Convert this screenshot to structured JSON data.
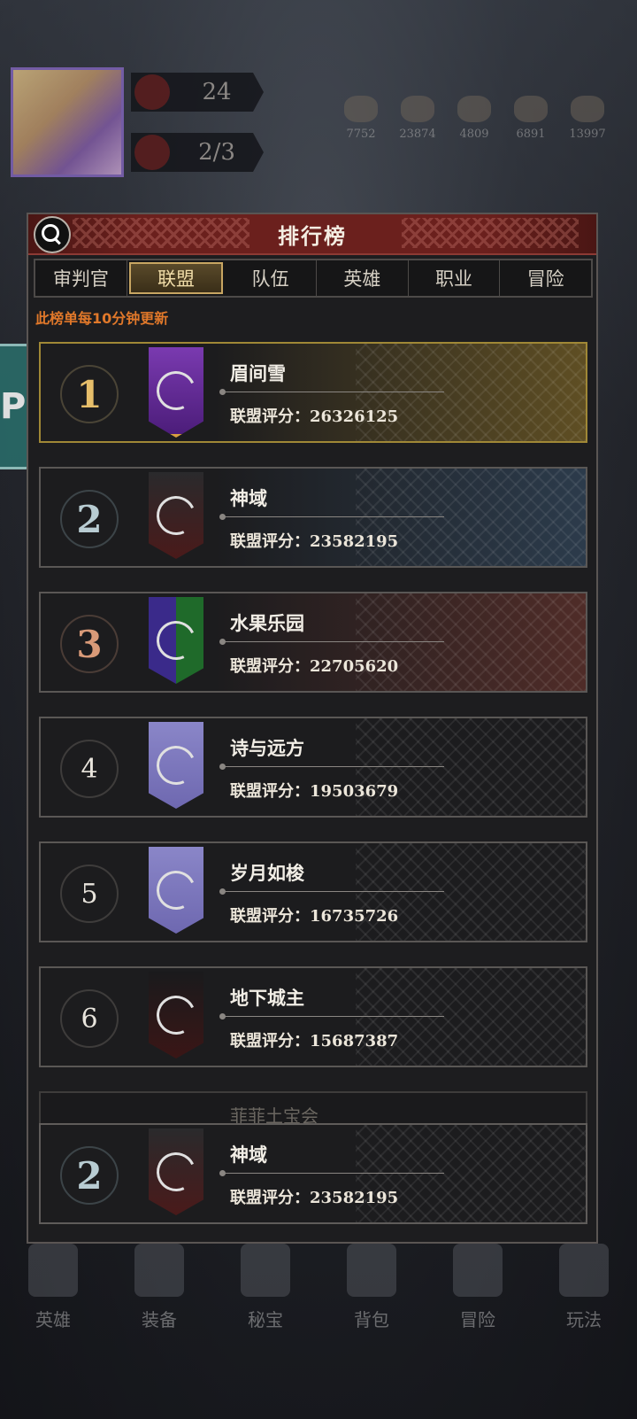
{
  "hud": {
    "level": "24",
    "stamina": "2/3",
    "resources": [
      "7752",
      "23874",
      "4809",
      "6891",
      "13997"
    ]
  },
  "side_button_label": "P",
  "panel": {
    "title": "排行榜",
    "tabs": [
      "审判官",
      "联盟",
      "队伍",
      "英雄",
      "职业",
      "冒险"
    ],
    "active_tab": "联盟",
    "notice": "此榜单每10分钟更新"
  },
  "rankings": [
    {
      "rank": "1",
      "name": "眉间雪",
      "score": "联盟评分：26326125"
    },
    {
      "rank": "2",
      "name": "神域",
      "score": "联盟评分：23582195"
    },
    {
      "rank": "3",
      "name": "水果乐园",
      "score": "联盟评分：22705620"
    },
    {
      "rank": "4",
      "name": "诗与远方",
      "score": "联盟评分：19503679"
    },
    {
      "rank": "5",
      "name": "岁月如梭",
      "score": "联盟评分：16735726"
    },
    {
      "rank": "6",
      "name": "地下城主",
      "score": "联盟评分：15687387"
    }
  ],
  "partial_row_name": "菲菲土宝会",
  "my_alliance": {
    "rank": "2",
    "name": "神域",
    "score": "联盟评分：23582195"
  },
  "bottom_nav": [
    "英雄",
    "装备",
    "秘宝",
    "背包",
    "冒险",
    "玩法"
  ]
}
